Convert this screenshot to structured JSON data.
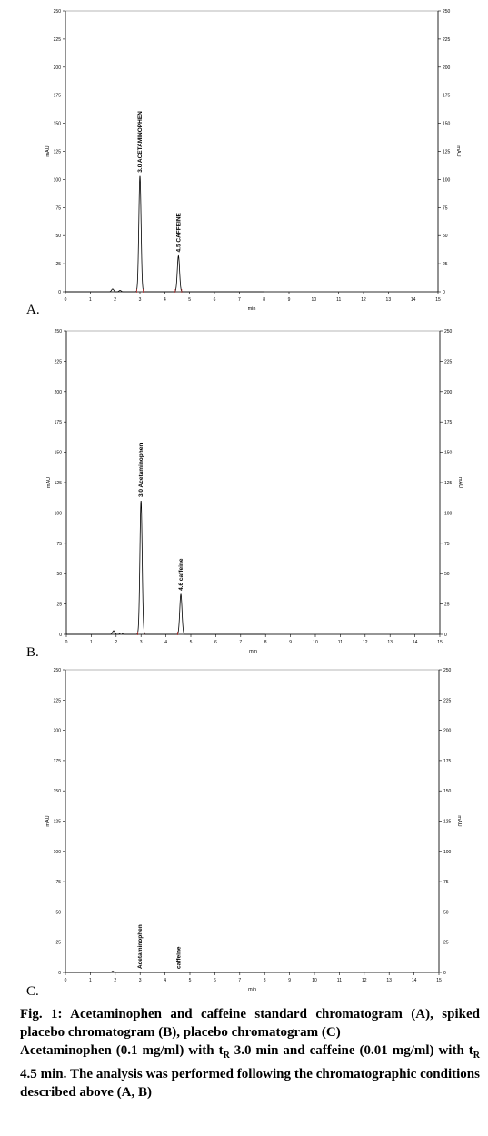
{
  "chart_data": [
    {
      "type": "line",
      "panel_label": "A.",
      "xlabel": "min",
      "ylabel_left": "mAU",
      "ylabel_right": "mAU",
      "xlim": [
        0,
        15
      ],
      "ylim": [
        0,
        250
      ],
      "x_ticks": [
        "0",
        "1",
        "2",
        "3",
        "4",
        "5",
        "6",
        "7",
        "8",
        "9",
        "10",
        "11",
        "12",
        "13",
        "14",
        "15"
      ],
      "y_ticks_left": [
        "0",
        "25",
        "50",
        "75",
        "100",
        "125",
        "150",
        "175",
        "200",
        "225",
        "250"
      ],
      "y_ticks_right": [
        "0",
        "25",
        "50",
        "75",
        "100",
        "125",
        "150",
        "175",
        "200",
        "225",
        "250"
      ],
      "trace_end_min": 8,
      "peaks": [
        {
          "label": "3.0  ACETAMINOPHEN",
          "rt": 3.0,
          "height": 103
        },
        {
          "label": "4.5  CAFFEINE",
          "rt": 4.55,
          "height": 32
        },
        {
          "label": "",
          "rt": 1.9,
          "height": 2.5
        },
        {
          "label": "",
          "rt": 2.2,
          "height": 1.2
        }
      ]
    },
    {
      "type": "line",
      "panel_label": "B.",
      "xlabel": "min",
      "ylabel_left": "mAU",
      "ylabel_right": "mAU",
      "xlim": [
        0,
        15
      ],
      "ylim": [
        0,
        250
      ],
      "x_ticks": [
        "0",
        "1",
        "2",
        "3",
        "4",
        "5",
        "6",
        "7",
        "8",
        "9",
        "10",
        "11",
        "12",
        "13",
        "14",
        "15"
      ],
      "y_ticks_left": [
        "0",
        "25",
        "50",
        "75",
        "100",
        "125",
        "150",
        "175",
        "200",
        "225",
        "250"
      ],
      "y_ticks_right": [
        "0",
        "25",
        "50",
        "75",
        "100",
        "125",
        "150",
        "175",
        "200",
        "225",
        "250"
      ],
      "trace_end_min": 8,
      "peaks": [
        {
          "label": "Acetaminophen",
          "rt_label": "3.0",
          "rt": 3.0,
          "height": 110
        },
        {
          "label": "caffeine",
          "rt_label": "4.6",
          "rt": 4.6,
          "height": 33
        },
        {
          "label": "",
          "rt": 1.9,
          "height": 3
        },
        {
          "label": "",
          "rt": 2.2,
          "height": 1.2
        }
      ]
    },
    {
      "type": "line",
      "panel_label": "C.",
      "xlabel": "min",
      "ylabel_left": "mAU",
      "ylabel_right": "mAU",
      "xlim": [
        0,
        15
      ],
      "ylim": [
        0,
        250
      ],
      "x_ticks": [
        "0",
        "1",
        "2",
        "3",
        "4",
        "5",
        "6",
        "7",
        "8",
        "9",
        "10",
        "11",
        "12",
        "13",
        "14",
        "15"
      ],
      "y_ticks_left": [
        "0",
        "25",
        "50",
        "75",
        "100",
        "125",
        "150",
        "175",
        "200",
        "225",
        "250"
      ],
      "y_ticks_right": [
        "0",
        "25",
        "50",
        "75",
        "100",
        "125",
        "150",
        "175",
        "200",
        "225",
        "250"
      ],
      "trace_end_min": 8,
      "peaks": [
        {
          "label": "Acetaminophen",
          "rt": 3.0,
          "height": 0
        },
        {
          "label": "caffeine",
          "rt": 4.55,
          "height": 0
        },
        {
          "label": "",
          "rt": 1.9,
          "height": 1
        }
      ]
    }
  ],
  "caption": {
    "fig_label": "Fig. 1:",
    "fig_text": "Acetaminophen and caffeine standard chromatogram (A), spiked placebo chromatogram (B), placebo chromatogram (C)",
    "note_part1": "Acetaminophen (0.1 mg/ml) with t",
    "note_sub1": "R",
    "note_part2": " 3.0 min and caffeine (0.01 mg/ml) with t",
    "note_sub2": "R",
    "note_part3": " 4.5 min. The analysis was performed following the chromatographic conditions described above (A, B)"
  },
  "colors": {
    "trace": "#000000",
    "marker": "#cc3333",
    "axis": "#000000"
  }
}
